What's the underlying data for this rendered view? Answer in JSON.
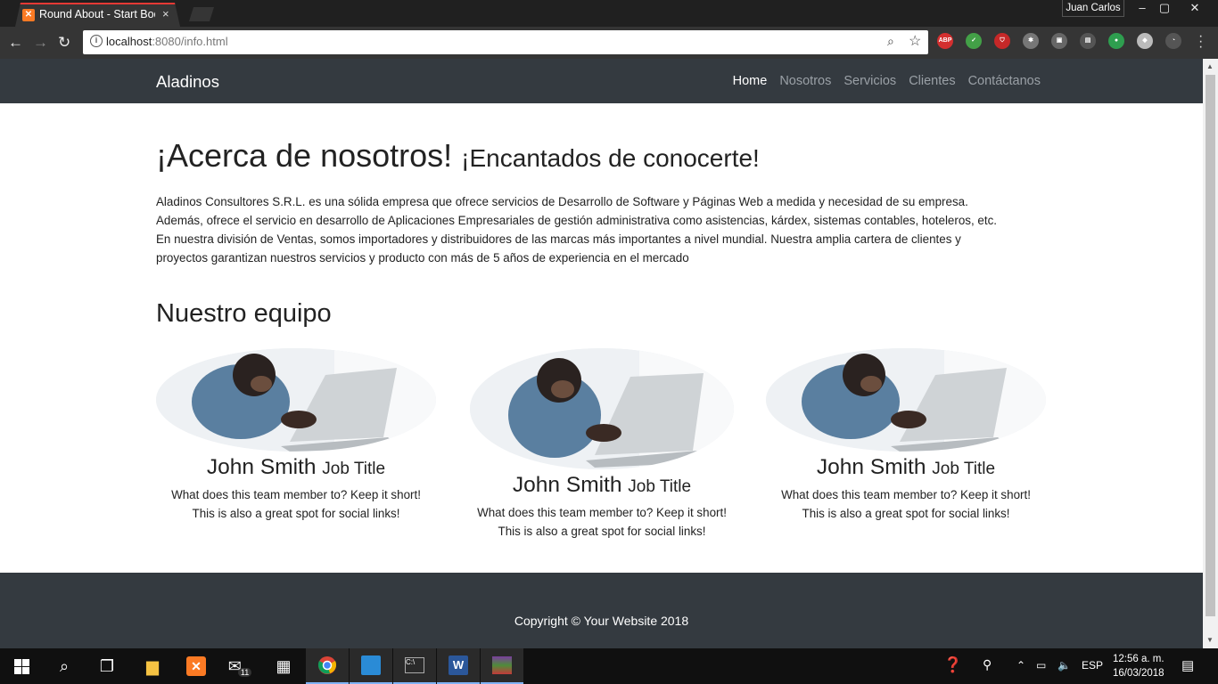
{
  "browser": {
    "tab_title": "Round About - Start Boo",
    "tab_close": "×",
    "user_name": "Juan Carlos",
    "url_host": "localhost",
    "url_path": ":8080/info.html",
    "window_buttons": [
      "–",
      "▢",
      "✕"
    ],
    "extensions": [
      {
        "name": "adblock-plus-icon",
        "text": "ABP",
        "color": "#d32f2f"
      },
      {
        "name": "shield-check-icon",
        "text": "✓",
        "color": "#43a047"
      },
      {
        "name": "ublock-icon",
        "text": "⛉",
        "color": "#c62828"
      },
      {
        "name": "puzzle-icon",
        "text": "✱",
        "color": "#777777"
      },
      {
        "name": "briefcase-icon",
        "text": "▣",
        "color": "#666666"
      },
      {
        "name": "pdf-icon",
        "text": "▤",
        "color": "#555555"
      },
      {
        "name": "evernote-icon",
        "text": "●",
        "color": "#2e9e4f"
      },
      {
        "name": "cube-icon",
        "text": "◆",
        "color": "#bbbbbb"
      },
      {
        "name": "sync-icon",
        "text": "◔",
        "color": "#555555"
      }
    ]
  },
  "site": {
    "brand": "Aladinos",
    "nav": [
      "Home",
      "Nosotros",
      "Servicios",
      "Clientes",
      "Contáctanos"
    ],
    "heading": "¡Acerca de nosotros!",
    "subheading": "¡Encantados de conocerte!",
    "about_lines": [
      "Aladinos Consultores S.R.L. es una sólida empresa que ofrece servicios de Desarrollo de Software y Páginas Web a medida y necesidad de su empresa.",
      "Además, ofrece el servicio en desarrollo de Aplicaciones Empresariales de gestión administrativa como asistencias, kárdex, sistemas contables, hoteleros, etc.",
      "En nuestra división de Ventas, somos importadores y distribuidores de las marcas más importantes a nivel mundial. Nuestra amplia cartera de clientes y",
      "proyectos garantizan nuestros servicios y producto con más de 5 años de experiencia en el mercado"
    ],
    "team_heading": "Nuestro equipo",
    "team": [
      {
        "name": "John Smith",
        "title": "Job Title",
        "line1": "What does this team member to? Keep it short!",
        "line2": "This is also a great spot for social links!"
      },
      {
        "name": "John Smith",
        "title": "Job Title",
        "line1": "What does this team member to? Keep it short!",
        "line2": "This is also a great spot for social links!"
      },
      {
        "name": "John Smith",
        "title": "Job Title",
        "line1": "What does this team member to? Keep it short!",
        "line2": "This is also a great spot for social links!"
      }
    ],
    "footer": "Copyright © Your Website 2018"
  },
  "taskbar": {
    "mail_badge": "11",
    "language": "ESP",
    "time": "12:56 a. m.",
    "date": "16/03/2018"
  }
}
